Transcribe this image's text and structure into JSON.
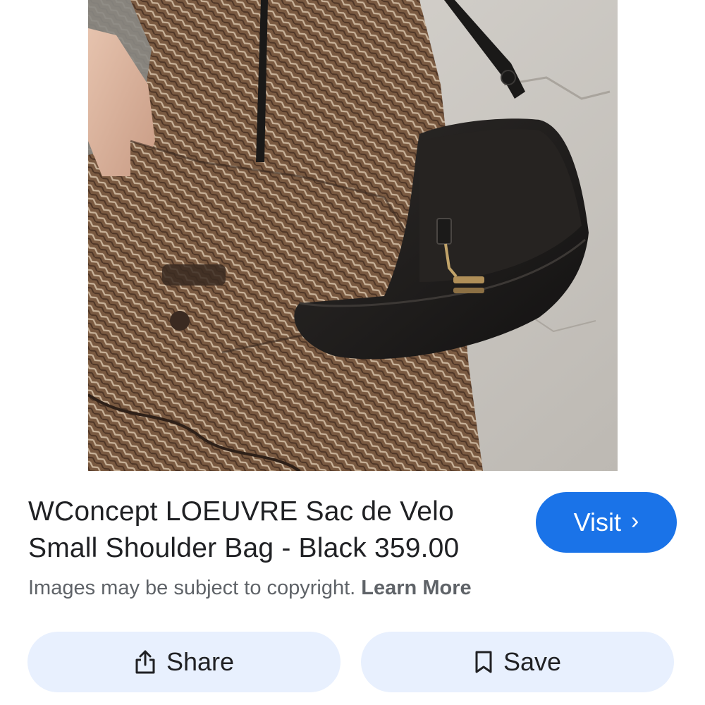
{
  "product": {
    "title_line1": "WConcept LOEUVRE Sac de Velo",
    "title_line2": "Small Shoulder Bag - Black 359.00"
  },
  "visit_button": {
    "label": "Visit",
    "chevron": "›",
    "icon": "chevron-right-icon",
    "color": "#1a73e8"
  },
  "notice": {
    "text": "Images may be subject to copyright.",
    "link_label": "Learn More"
  },
  "actions": {
    "share_label": "Share",
    "share_icon": "share-icon",
    "save_label": "Save",
    "save_icon": "bookmark-icon",
    "button_color": "#e8f0fe"
  },
  "image": {
    "subject": "tweed-coat-black-leather-shoulder-bag"
  }
}
